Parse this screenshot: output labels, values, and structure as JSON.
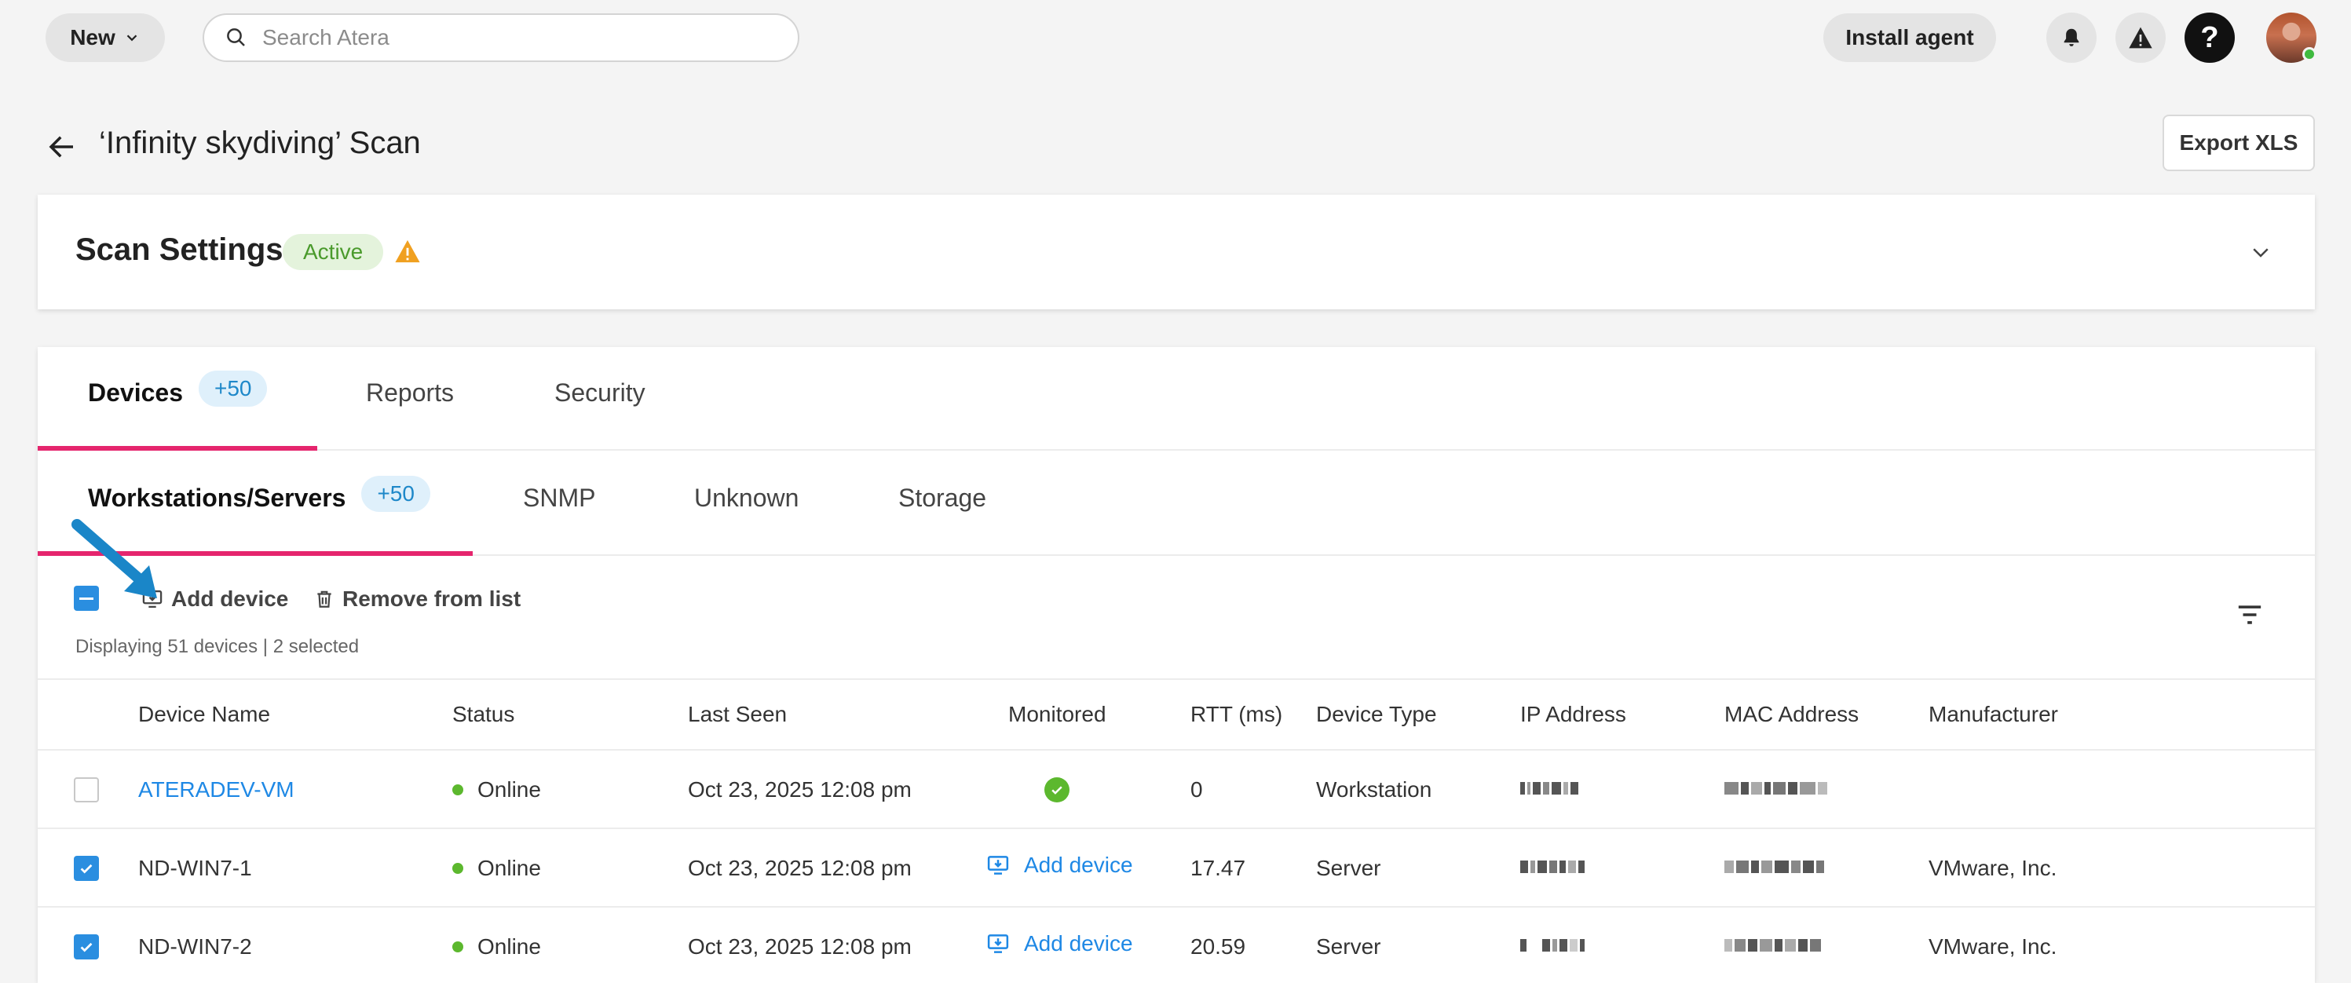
{
  "topbar": {
    "new_label": "New",
    "search_placeholder": "Search Atera",
    "install_label": "Install agent",
    "help_label": "?"
  },
  "page": {
    "title": "‘Infinity skydiving’ Scan",
    "export_label": "Export XLS"
  },
  "settings": {
    "title": "Scan Settings",
    "status": "Active"
  },
  "tabs_main": [
    {
      "label": "Devices",
      "badge": "+50"
    },
    {
      "label": "Reports"
    },
    {
      "label": "Security"
    }
  ],
  "tabs_sub": [
    {
      "label": "Workstations/Servers",
      "badge": "+50"
    },
    {
      "label": "SNMP"
    },
    {
      "label": "Unknown"
    },
    {
      "label": "Storage"
    }
  ],
  "toolbar": {
    "add_device": "Add device",
    "remove": "Remove from list",
    "summary": "Displaying 51 devices | 2 selected"
  },
  "table": {
    "columns": [
      "Device Name",
      "Status",
      "Last Seen",
      "Monitored",
      "RTT (ms)",
      "Device Type",
      "IP Address",
      "MAC Address",
      "Manufacturer"
    ],
    "rows": [
      {
        "name": "ATERADEV-VM",
        "status": "Online",
        "last_seen": "Oct 23, 2025 12:08 pm",
        "monitored": "check",
        "rtt": "0",
        "type": "Workstation",
        "manufacturer": "",
        "checked": false
      },
      {
        "name": "ND-WIN7-1",
        "status": "Online",
        "last_seen": "Oct 23, 2025 12:08 pm",
        "monitored": "Add device",
        "rtt": "17.47",
        "type": "Server",
        "manufacturer": "VMware, Inc.",
        "checked": true
      },
      {
        "name": "ND-WIN7-2",
        "status": "Online",
        "last_seen": "Oct 23, 2025 12:08 pm",
        "monitored": "Add device",
        "rtt": "20.59",
        "type": "Server",
        "manufacturer": "VMware, Inc.",
        "checked": true
      }
    ]
  },
  "colors": {
    "accent_pink": "#e5256d",
    "link_blue": "#1e88e5",
    "checkbox_blue": "#2a8ee0",
    "online_green": "#5cb82e",
    "warning_orange": "#f0a020"
  }
}
